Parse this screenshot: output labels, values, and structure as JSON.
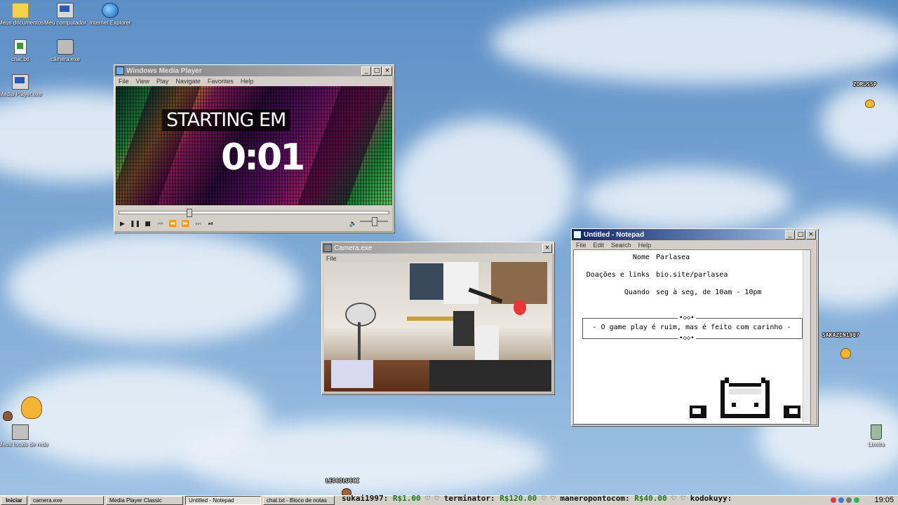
{
  "desktop": {
    "icons": [
      {
        "label": "Meus documentos",
        "icon": "folder-icon"
      },
      {
        "label": "Meu computador",
        "icon": "computer-icon"
      },
      {
        "label": "Internet Explorer",
        "icon": "internet-explorer-icon"
      },
      {
        "label": "chat.txt",
        "icon": "text-file-icon"
      },
      {
        "label": "câmera.exe",
        "icon": "camera-icon"
      },
      {
        "label": "Media Player.exe",
        "icon": "media-player-icon"
      },
      {
        "label": "Meus locais de rede",
        "icon": "network-icon"
      },
      {
        "label": "Lixeira",
        "icon": "recycle-bin-icon"
      }
    ],
    "viewers": [
      "ZORUSSP",
      "SAKAZIN1987",
      "LEOCOLUCCI"
    ]
  },
  "media_player": {
    "title": "Windows Media Player",
    "menu": [
      "File",
      "View",
      "Play",
      "Navigate",
      "Favorites",
      "Help"
    ],
    "overlay_text": "STARTING EM",
    "countdown": "0:01",
    "seek_fraction": 0.25,
    "volume_fraction": 0.5
  },
  "camera": {
    "title": "Camera.exe",
    "menu": [
      "File"
    ]
  },
  "notepad": {
    "title": "Untitled - Notepad",
    "menu": [
      "File",
      "Edit",
      "Search",
      "Help"
    ],
    "rows": [
      {
        "key": "Nome",
        "value": "Parlasea"
      },
      {
        "key": "Doações e links",
        "value": "bio.site/parlasea"
      },
      {
        "key": "Quando",
        "value": "seg à seg, de 10am - 10pm"
      }
    ],
    "ornament": "•◇◇•",
    "motto": "- O game play é ruim, mas é feito com carinho -"
  },
  "taskbar": {
    "start_label": "Iniciar",
    "buttons": [
      "camera.exe",
      "Media Player Classic",
      "Untitled - Notepad",
      "chat.txt - Bloco de notas"
    ],
    "active_index": 2,
    "clock": "19:05"
  },
  "ticker": [
    {
      "name": "sukai1997:",
      "amount": "R$1.00"
    },
    {
      "name": "terminator:",
      "amount": "R$120.00"
    },
    {
      "name": "maneropontocom:",
      "amount": "R$40.00"
    },
    {
      "name": "kodokuyy:",
      "amount": ""
    }
  ],
  "ticker_separator": "♡",
  "colors": {
    "titlebar_active": "#0a246a",
    "ticker_amount": "#1c7a1c",
    "desktop_sky": "#7aa6d3"
  }
}
